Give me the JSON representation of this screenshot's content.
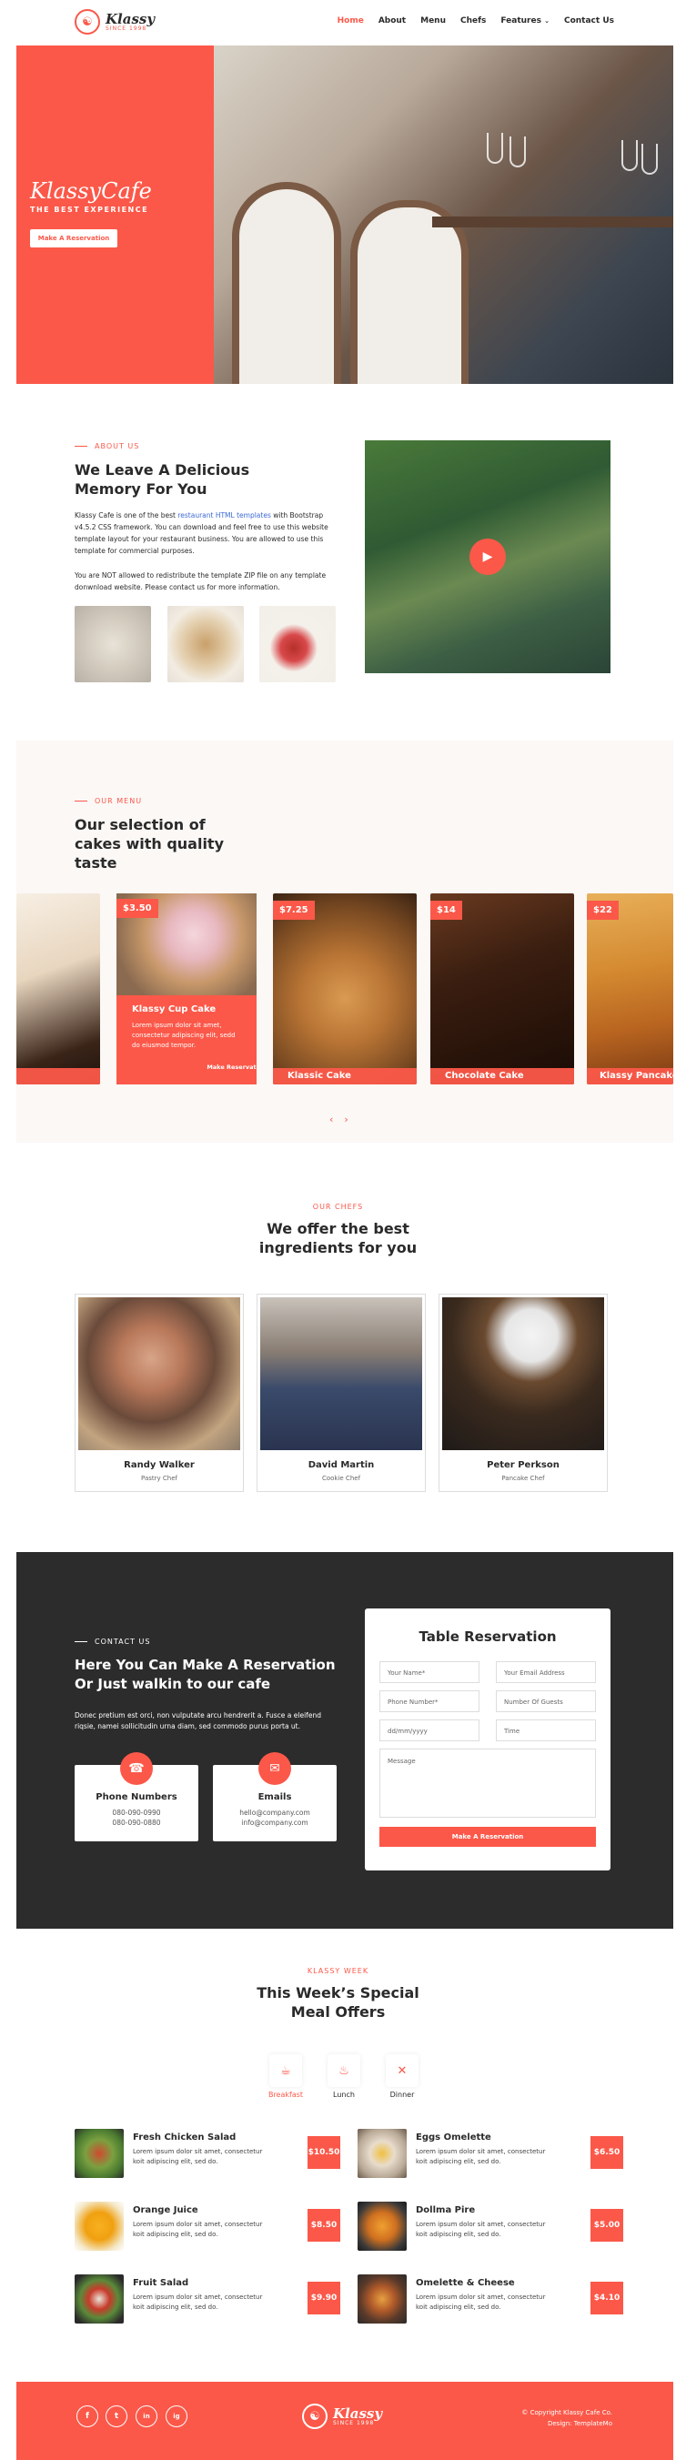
{
  "brand": {
    "name": "Klassy",
    "since": "SINCE 1998"
  },
  "nav": {
    "home": "Home",
    "about": "About",
    "menu": "Menu",
    "chefs": "Chefs",
    "features": "Features",
    "contact": "Contact Us"
  },
  "hero": {
    "title": "KlassyCafe",
    "subtitle": "THE BEST EXPERIENCE",
    "button": "Make A Reservation"
  },
  "about": {
    "tag": "ABOUT US",
    "title": "We Leave A Delicious Memory For You",
    "p1_a": "Klassy Cafe is one of the best ",
    "p1_link": "restaurant HTML templates",
    "p1_b": " with Bootstrap v4.5.2 CSS framework. You can download and feel free to use this website template layout for your restaurant business. You are allowed to use this template for commercial purposes.",
    "p2": "You are NOT allowed to redistribute the template ZIP file on any template donwnload website. Please contact us for more information."
  },
  "menu": {
    "tag": "OUR MENU",
    "title": "Our selection of cakes with quality taste",
    "featured": {
      "price": "$3.50",
      "name": "Klassy Cup Cake",
      "desc": "Lorem ipsum dolor sit amet, consectetur adipiscing elit, sedd do eiusmod tempor.",
      "button": "Make Reservation →"
    },
    "items": [
      {
        "price": "$7.25",
        "name": "Klassic Cake"
      },
      {
        "price": "$14",
        "name": "Chocolate Cake"
      },
      {
        "price": "$22",
        "name": "Klassy Pancake"
      }
    ],
    "prev": "‹",
    "next": "›"
  },
  "chefs": {
    "tag": "OUR CHEFS",
    "title": "We offer the best ingredients for you",
    "list": [
      {
        "name": "Randy Walker",
        "role": "Pastry Chef"
      },
      {
        "name": "David Martin",
        "role": "Cookie Chef"
      },
      {
        "name": "Peter Perkson",
        "role": "Pancake Chef"
      }
    ]
  },
  "reservation": {
    "tag": "CONTACT US",
    "title": "Here You Can Make A Reservation Or Just walkin to our cafe",
    "desc": "Donec pretium est orci, non vulputate arcu hendrerit a. Fusce a eleifend riqsie, namei sollicitudin urna diam, sed commodo purus porta ut.",
    "phone": {
      "title": "Phone Numbers",
      "line1": "080-090-0990",
      "line2": "080-090-0880"
    },
    "email": {
      "title": "Emails",
      "line1": "hello@company.com",
      "line2": "info@company.com"
    },
    "form": {
      "title": "Table Reservation",
      "name": "Your Name*",
      "email": "Your Email Address",
      "phone": "Phone Number*",
      "guests": "Number Of Guests",
      "date": "dd/mm/yyyy",
      "time": "Time",
      "message": "Message",
      "submit": "Make A Reservation"
    }
  },
  "week": {
    "tag": "KLASSY WEEK",
    "title": "This Week’s Special Meal Offers",
    "tabs": [
      {
        "label": "Breakfast"
      },
      {
        "label": "Lunch"
      },
      {
        "label": "Dinner"
      }
    ],
    "meals": [
      {
        "name": "Fresh Chicken Salad",
        "desc": "Lorem ipsum dolor sit amet, consectetur koit adipiscing elit, sed do.",
        "price": "$10.50"
      },
      {
        "name": "Eggs Omelette",
        "desc": "Lorem ipsum dolor sit amet, consectetur koit adipiscing elit, sed do.",
        "price": "$6.50"
      },
      {
        "name": "Orange Juice",
        "desc": "Lorem ipsum dolor sit amet, consectetur koit adipiscing elit, sed do.",
        "price": "$8.50"
      },
      {
        "name": "Dollma Pire",
        "desc": "Lorem ipsum dolor sit amet, consectetur koit adipiscing elit, sed do.",
        "price": "$5.00"
      },
      {
        "name": "Fruit Salad",
        "desc": "Lorem ipsum dolor sit amet, consectetur koit adipiscing elit, sed do.",
        "price": "$9.90"
      },
      {
        "name": "Omelette & Cheese",
        "desc": "Lorem ipsum dolor sit amet, consectetur koit adipiscing elit, sed do.",
        "price": "$4.10"
      }
    ]
  },
  "footer": {
    "social": [
      "f",
      "t",
      "in",
      "ig"
    ],
    "copyright": "© Copyright Klassy Cafe Co.",
    "design": "Design: TemplateMo"
  },
  "colors": {
    "accent": "#fb5849",
    "dark": "#2c2c2c"
  }
}
